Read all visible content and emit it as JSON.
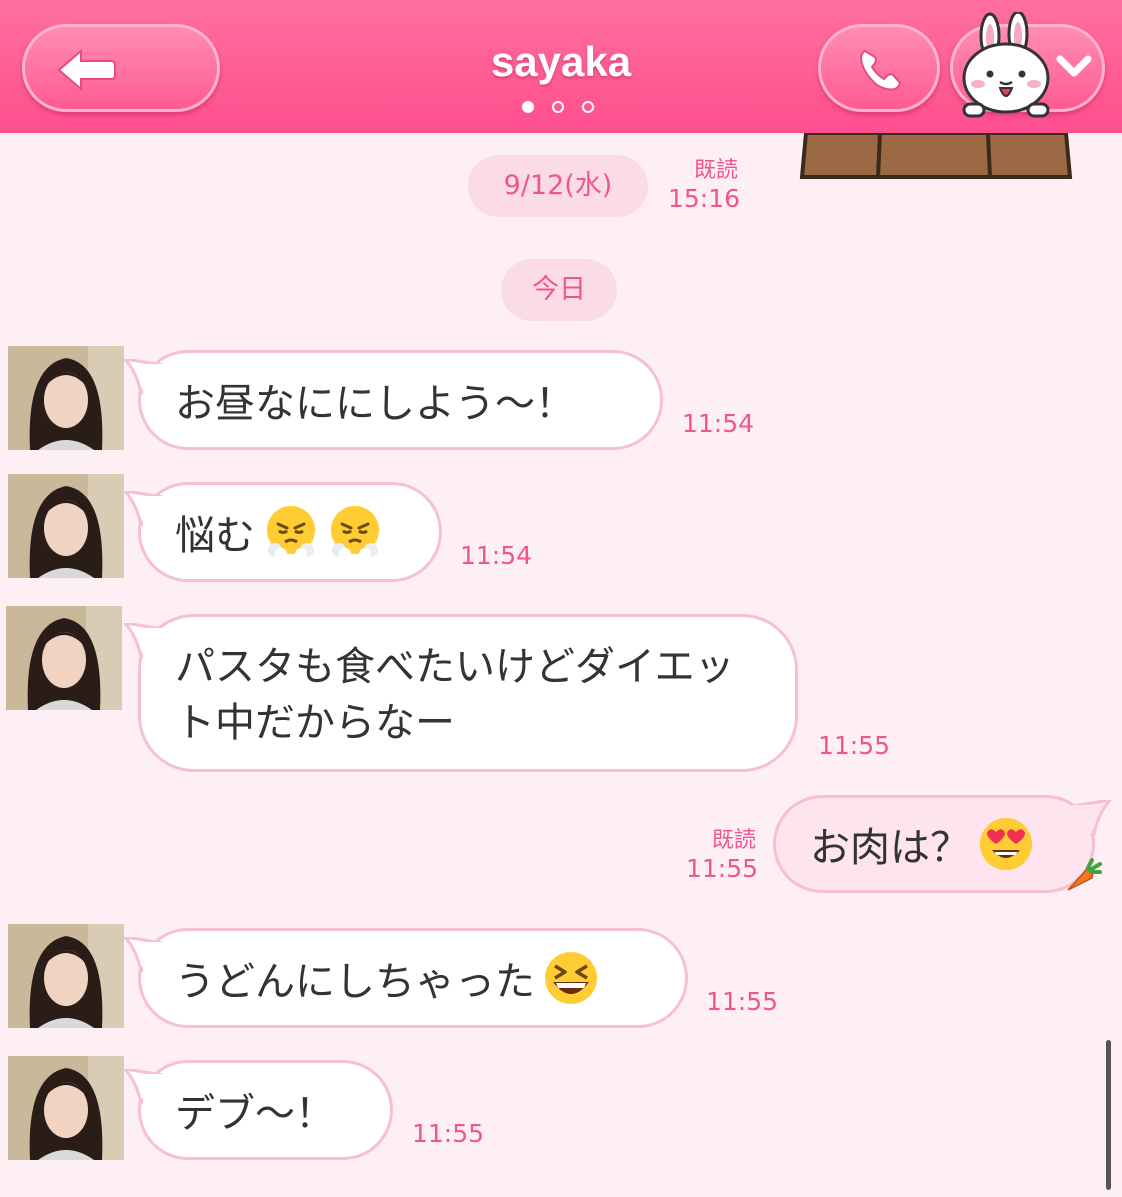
{
  "header": {
    "title": "sayaka",
    "page_dots": 3,
    "active_dot": 0
  },
  "dividers": [
    {
      "label": "9/12(水)",
      "read": "既読",
      "time": "15:16"
    },
    {
      "label": "今日"
    }
  ],
  "messages": [
    {
      "sender": "sayaka",
      "text": "お昼なににしよう〜！",
      "time": "11:54"
    },
    {
      "sender": "sayaka",
      "text": "悩む",
      "emoji": [
        "face-with-steam-icon",
        "face-with-steam-icon"
      ],
      "time": "11:54"
    },
    {
      "sender": "sayaka",
      "text": "パスタも食べたいけどダイエット中だからなー",
      "time": "11:55"
    },
    {
      "sender": "me",
      "text": "お肉は？",
      "emoji": [
        "heart-eyes-face-icon"
      ],
      "read": "既読",
      "time": "11:55"
    },
    {
      "sender": "sayaka",
      "text": "うどんにしちゃった",
      "emoji": [
        "grinning-squinting-face-icon"
      ],
      "time": "11:55"
    },
    {
      "sender": "sayaka",
      "text": "デブ〜！",
      "time": "11:55"
    }
  ],
  "colors": {
    "header": "#ff5a94",
    "background": "#fdeff4",
    "accent_text": "#ef5690",
    "bubble_border": "#f7bfd2"
  }
}
